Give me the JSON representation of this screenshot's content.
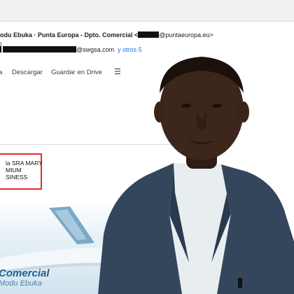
{
  "email": {
    "from_name": "odu Ebuka · Punta Europa - Dpto. Comercial <",
    "from_domain": "@puntaeuropa.eu>",
    "to_text": "t",
    "cc_domain": "@swgsa.com",
    "cc_more": "y otros 5"
  },
  "attachment_bar": {
    "partial_label": "a",
    "download_label": "Descargar",
    "save_drive_label": "Guardar en Drive",
    "list_icon": "list-icon"
  },
  "ticket": {
    "line1": "la SRA MARY",
    "line2": "MIUM",
    "line3": "SINESS"
  },
  "banner": {
    "title": "Comercial",
    "subtitle": "Modu Ebuka"
  },
  "colors": {
    "highlight_border": "#e0302a",
    "brand_blue": "#1f5f8f",
    "link_blue": "#1a73e8",
    "suit": "#34465c"
  }
}
